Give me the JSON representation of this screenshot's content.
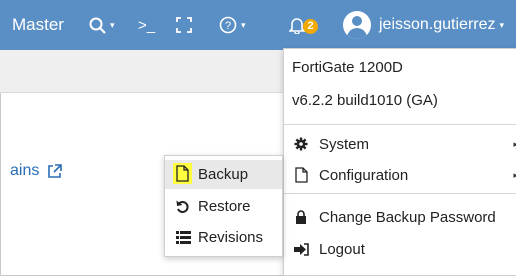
{
  "topbar": {
    "vdom_label": "Master",
    "cli_symbol": ">_",
    "notification_count": "2",
    "username": "jeisson.gutierrez"
  },
  "page": {
    "domain_link": "ains"
  },
  "user_menu": {
    "device_model": "FortiGate 1200D",
    "firmware": "v6.2.2 build1010 (GA)",
    "items": [
      {
        "label": "System",
        "icon": "gear-icon"
      },
      {
        "label": "Configuration",
        "icon": "file-icon"
      },
      {
        "label": "Change Backup Password",
        "icon": "lock-icon"
      },
      {
        "label": "Logout",
        "icon": "logout-icon"
      }
    ]
  },
  "config_submenu": {
    "items": [
      {
        "label": "Backup",
        "icon": "file-icon"
      },
      {
        "label": "Restore",
        "icon": "undo-icon"
      },
      {
        "label": "Revisions",
        "icon": "list-icon"
      }
    ]
  },
  "colors": {
    "topbar_bg": "#5a8fc5",
    "badge": "#f2a900",
    "highlight": "#ffff40",
    "link": "#2a6db5"
  }
}
